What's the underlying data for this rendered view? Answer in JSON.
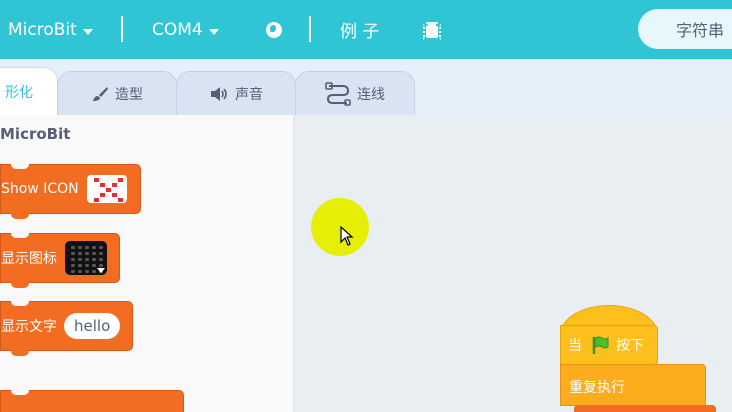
{
  "topbar": {
    "board": "MicroBit",
    "port": "COM4",
    "examples": "例 子",
    "serial": "字符串"
  },
  "tabs": [
    {
      "label": "形化",
      "icon": "",
      "active": true
    },
    {
      "label": "造型",
      "icon": "brush-icon"
    },
    {
      "label": "声音",
      "icon": "speaker-icon"
    },
    {
      "label": "连线",
      "icon": "wire-icon"
    }
  ],
  "palette": {
    "category": "MicroBit",
    "blocks": [
      {
        "label": "Show ICON"
      },
      {
        "label": "显示图标"
      },
      {
        "label": "显示文字",
        "input": "hello"
      }
    ]
  },
  "workspace": {
    "hat_left": "当",
    "hat_right": "按下",
    "repeat": "重复执行"
  },
  "colors": {
    "accent": "#2fc5d5",
    "block_orange": "#f26d21",
    "event_yellow": "#fdbf1b",
    "control_orange": "#fdac1d",
    "cursor_highlight": "#e6ee05"
  }
}
